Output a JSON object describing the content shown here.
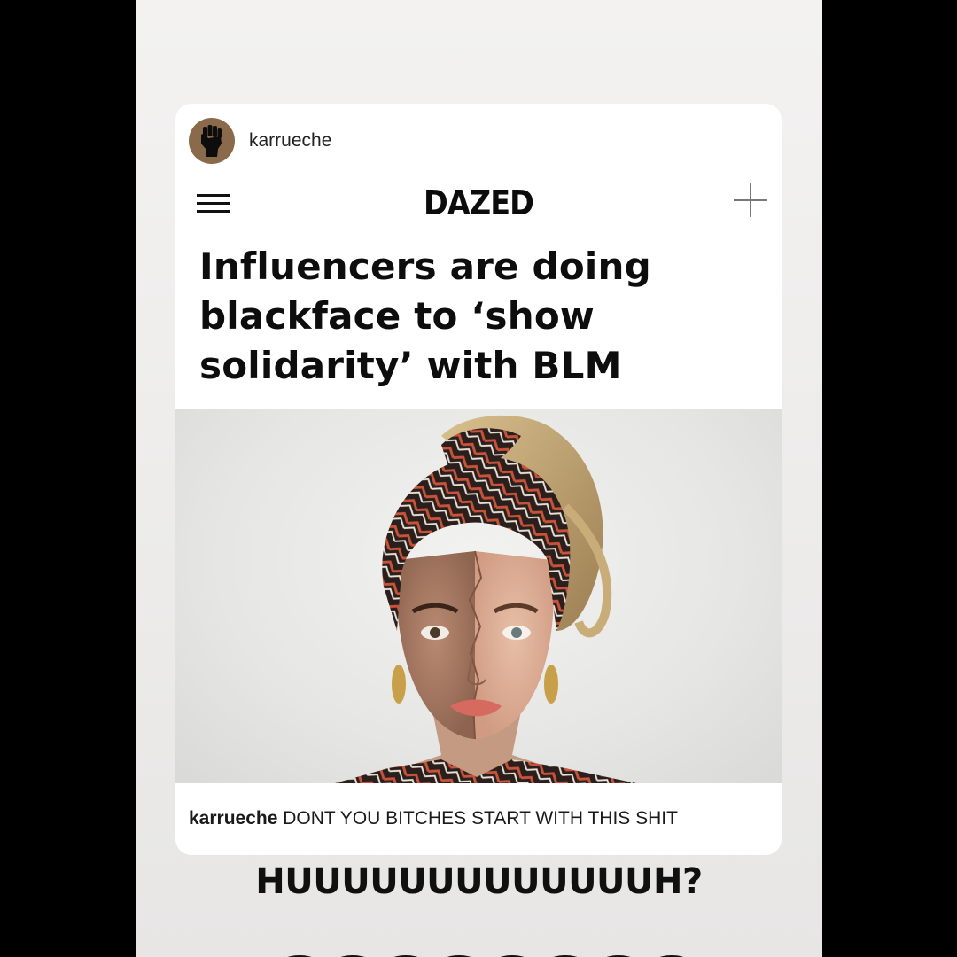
{
  "story": {
    "card": {
      "username": "karrueche",
      "brand": "DAZED",
      "headline": "Influencers are doing blackface to ‘show solidarity’ with BLM",
      "caption_user": "karrueche",
      "caption_text": " DONT YOU BITCHES START WITH THIS SHIT",
      "avatar_icon": "raised-fist-icon",
      "menu_icon": "hamburger-menu-icon",
      "plus_icon": "plus-icon"
    },
    "overlay_text": "HUUUUUUUUUUUUUH?"
  },
  "colors": {
    "background": "#000000",
    "story_bg": "#efeeed",
    "card_bg": "#ffffff",
    "avatar_bg": "#8a6a4a",
    "text": "#111111"
  }
}
